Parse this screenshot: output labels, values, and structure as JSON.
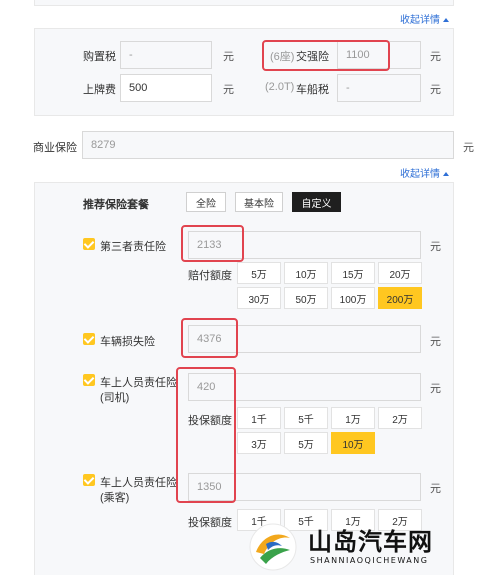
{
  "tax_panel": {
    "collapse_label": "收起详情",
    "purchase_tax": {
      "label": "购置税",
      "value": "-",
      "unit": "元"
    },
    "compulsory": {
      "prefix": "(6座)",
      "label": "交强险",
      "value": "1100",
      "unit": "元"
    },
    "plate_fee": {
      "label": "上牌费",
      "value": "500",
      "unit": "元"
    },
    "vessel_tax": {
      "prefix": "(2.0T)",
      "label": "车船税",
      "value": "-",
      "unit": "元"
    }
  },
  "commercial": {
    "label": "商业保险",
    "value": "8279",
    "unit": "元",
    "collapse_label": "收起详情"
  },
  "packages": {
    "label": "推荐保险套餐",
    "options": [
      "全险",
      "基本险",
      "自定义"
    ],
    "selected": "自定义"
  },
  "items": {
    "third_party": {
      "label": "第三者责任险",
      "value": "2133",
      "unit": "元",
      "sub_label": "赔付额度",
      "options": [
        "5万",
        "10万",
        "15万",
        "20万",
        "30万",
        "50万",
        "100万",
        "200万"
      ],
      "selected": "200万"
    },
    "vehicle_damage": {
      "label": "车辆损失险",
      "value": "4376",
      "unit": "元"
    },
    "driver": {
      "label": "车上人员责任险",
      "label2": "(司机)",
      "value": "420",
      "unit": "元",
      "sub_label": "投保额度",
      "options": [
        "1千",
        "5千",
        "1万",
        "2万",
        "3万",
        "5万",
        "10万"
      ],
      "selected": "10万"
    },
    "passenger": {
      "label": "车上人员责任险",
      "label2": "(乘客)",
      "value": "1350",
      "unit": "元",
      "sub_label": "投保额度",
      "options": [
        "1千",
        "5千",
        "1万",
        "2万"
      ]
    }
  },
  "watermark": {
    "title": "山岛汽车网",
    "subtitle": "SHANNIAOQICHEWANG"
  },
  "colors": {
    "accent": "#ffc720",
    "highlight": "#e1444f",
    "link": "#2e6fd6"
  }
}
